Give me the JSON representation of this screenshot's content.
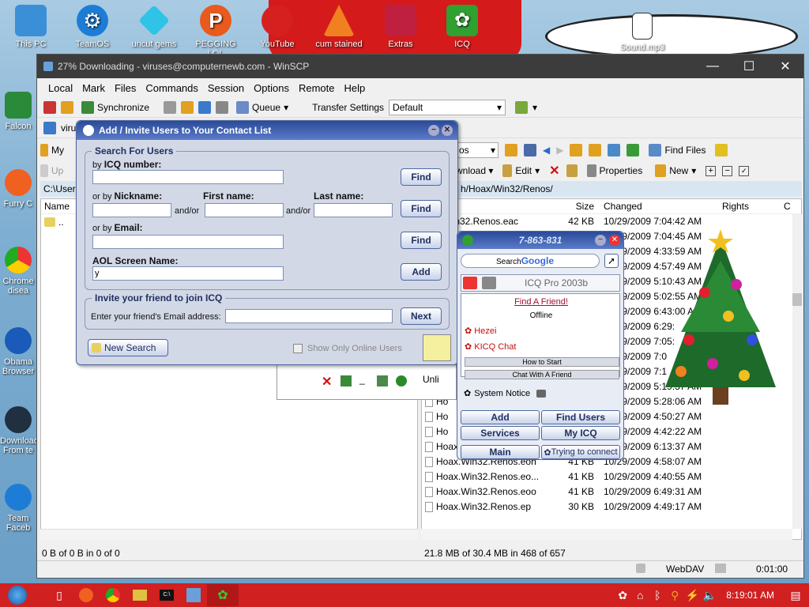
{
  "desktop": {
    "icons": [
      {
        "label": "This PC",
        "icon": "computer-icon",
        "color": "#3b8fd6"
      },
      {
        "label": "TeamOS",
        "icon": "gear-icon",
        "color": "#1d7dd6"
      },
      {
        "label": "uncut gems",
        "icon": "diamond-icon",
        "color": "#2fc3e8"
      },
      {
        "label": "PEGGING LOL",
        "icon": "p-letter-icon",
        "color": "#e85a1d"
      },
      {
        "label": "YouTube",
        "icon": "angry-bird-icon",
        "color": "#d62020"
      },
      {
        "label": "cum stained",
        "icon": "vlc-cone-icon",
        "color": "#f08020"
      },
      {
        "label": "Extras",
        "icon": "folder-icon",
        "color": "#c02040"
      },
      {
        "label": "ICQ",
        "icon": "icq-flower-icon",
        "color": "#30a030"
      },
      {
        "label": "Sound.mp3",
        "icon": "audio-file-icon",
        "color": "#ffffff"
      }
    ],
    "left_icons": [
      {
        "label": "Falcon",
        "icon": "falcon-icon"
      },
      {
        "label": "Furry C",
        "icon": "firefox-icon"
      },
      {
        "label": "Chrome\ndisea",
        "icon": "chrome-icon"
      },
      {
        "label": "Obama\nBrowser",
        "icon": "obama-logo-icon"
      },
      {
        "label": "Download\nFrom te",
        "icon": "notepad-icon"
      },
      {
        "label": "Team\nFaceb",
        "icon": "gear-icon"
      }
    ]
  },
  "winscp": {
    "title": "27% Downloading - viruses@computernewb.com - WinSCP",
    "menu": [
      "Local",
      "Mark",
      "Files",
      "Commands",
      "Session",
      "Options",
      "Remote",
      "Help"
    ],
    "toolbar": {
      "synchronize": "Synchronize",
      "queue": "Queue",
      "transfer_label": "Transfer Settings",
      "transfer_value": "Default"
    },
    "left": {
      "tab": "My",
      "path": "C:\\Users",
      "name_col": "Name",
      "parent": "..",
      "upload": "Up",
      "session": "viru"
    },
    "right": {
      "path": "h/Hoax/Win32/Renos/",
      "dropdown": "os",
      "find_files": "Find Files",
      "actions": {
        "download": "wnload",
        "edit": "Edit",
        "properties": "Properties",
        "new": "New"
      },
      "columns": [
        "Size",
        "Changed",
        "Rights",
        "C"
      ],
      "rows": [
        {
          "name": "x.Win32.Renos.eac",
          "size": "42 KB",
          "changed": "10/29/2009 7:04:42 AM"
        },
        {
          "name": "",
          "size": "",
          "changed": "10/29/2009 7:04:45 AM"
        },
        {
          "name": "",
          "size": "",
          "changed": "10/29/2009 4:33:59 AM"
        },
        {
          "name": "",
          "size": "",
          "changed": "10/29/2009 4:57:49 AM"
        },
        {
          "name": "",
          "size": "",
          "changed": "10/29/2009 5:10:43 AM"
        },
        {
          "name": "",
          "size": "",
          "changed": "10/29/2009 5:02:55 AM"
        },
        {
          "name": "",
          "size": "",
          "changed": "10/29/2009 6:43:00 AM"
        },
        {
          "name": "",
          "size": "",
          "changed": "10/29/2009 6:29:"
        },
        {
          "name": "",
          "size": "",
          "changed": "10/29/2009 7:05:"
        },
        {
          "name": "",
          "size": "",
          "changed": "10/29/2009 7:0"
        },
        {
          "name": "",
          "size": "",
          "changed": "10/29/2009 7:1"
        },
        {
          "name": "Ho",
          "size": "",
          "changed": "10/29/2009 5:19:37 AM"
        },
        {
          "name": "Ho",
          "size": "",
          "changed": "10/29/2009 5:28:06 AM"
        },
        {
          "name": "Ho",
          "size": "",
          "changed": "10/29/2009 4:50:27 AM"
        },
        {
          "name": "Ho",
          "size": "",
          "changed": "10/29/2009 4:42:22 AM"
        },
        {
          "name": "Hoax.Win32.Renos.eoe",
          "size": "41 KB",
          "changed": "10/29/2009 6:13:37 AM"
        },
        {
          "name": "Hoax.Win32.Renos.eoh",
          "size": "41 KB",
          "changed": "10/29/2009 4:58:07 AM"
        },
        {
          "name": "Hoax.Win32.Renos.eo...",
          "size": "41 KB",
          "changed": "10/29/2009 4:40:55 AM"
        },
        {
          "name": "Hoax.Win32.Renos.eoo",
          "size": "41 KB",
          "changed": "10/29/2009 6:49:31 AM"
        },
        {
          "name": "Hoax.Win32.Renos.ep",
          "size": "30 KB",
          "changed": "10/29/2009 4:49:17 AM"
        }
      ]
    },
    "status_left": "0 B of 0 B in 0 of 0",
    "status_right": "21.8 MB of 30.4 MB in 468 of 657",
    "protocol": "WebDAV",
    "elapsed": "0:01:00",
    "hidden_panel": "Unli"
  },
  "icq_add": {
    "title": "Add / Invite Users to Your Contact  List",
    "search_group": "Search For Users",
    "by": "by",
    "icq_number": "ICQ number:",
    "or_by": "or by",
    "nickname": "Nickname:",
    "first_name": "First name:",
    "last_name": "Last name:",
    "andor": "and/or",
    "email": "Email:",
    "aol": "AOL Screen Name:",
    "aol_value": "y",
    "find": "Find",
    "add": "Add",
    "invite_group": "Invite your friend to join ICQ",
    "invite_label": "Enter your friend's Email address:",
    "next": "Next",
    "new_search": "New Search",
    "only_online": "Show Only Online Users"
  },
  "icq_list": {
    "uin": "7-863-831",
    "search": "Search",
    "google": "Google",
    "tab_title": "ICQ Pro 2003b",
    "find_friend": "Find A Friend!",
    "offline": "Offline",
    "contacts": [
      "Hezei",
      "KICQ Chat"
    ],
    "how_to": "How to Start",
    "chat_friend": "Chat With A Friend",
    "system_notice": "System Notice",
    "btn_add": "Add",
    "btn_find": "Find Users",
    "btn_services": "Services",
    "btn_myicq": "My ICQ",
    "btn_main": "Main",
    "status": "Trying to connect"
  },
  "taskbar": {
    "time": "8:19:01 AM",
    "colors": {
      "bar": "#d02020"
    }
  }
}
